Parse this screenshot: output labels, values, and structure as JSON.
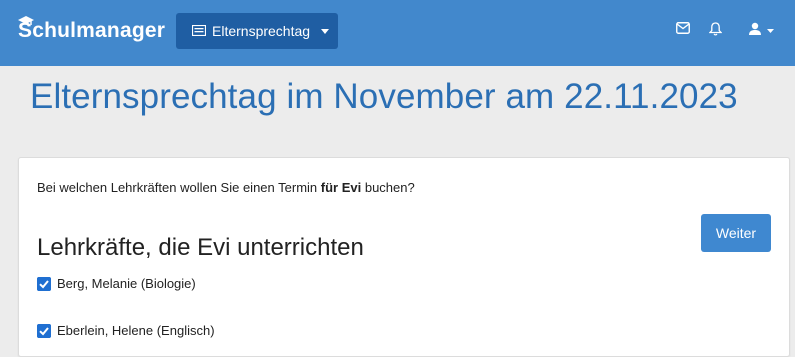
{
  "navbar": {
    "brand": "Schulmanager",
    "module_label": "Elternsprechtag",
    "icons": [
      "mail-icon",
      "bell-icon",
      "user-icon"
    ],
    "color": "#4288cc"
  },
  "page": {
    "title": "Elternsprechtag im November am 22.11.2023"
  },
  "card": {
    "prompt_before": "Bei welchen Lehrkräften wollen Sie einen Termin ",
    "prompt_bold": "für Evi",
    "prompt_after": " buchen?",
    "section_title": "Lehrkräfte, die Evi unterrichten",
    "weiter_label": "Weiter",
    "teachers": [
      {
        "name": "Berg, Melanie (Biologie)",
        "checked": true
      },
      {
        "name": "Eberlein, Helene (Englisch)",
        "checked": true
      }
    ]
  },
  "colors": {
    "accent": "#3f88d0",
    "title": "#2b6fb4",
    "checkbox": "#1f6fd1"
  }
}
